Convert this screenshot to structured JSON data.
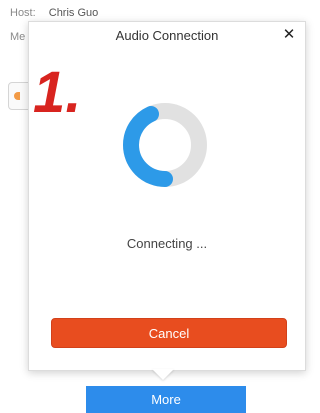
{
  "background": {
    "host_label": "Host:",
    "host_name": "Chris Guo",
    "meeting_label_partial": "Me",
    "more_label": "More"
  },
  "dialog": {
    "title": "Audio Connection",
    "close_glyph": "✕",
    "status_text": "Connecting ...",
    "cancel_label": "Cancel",
    "progress_fraction": 0.4
  },
  "annotation": {
    "step": "1."
  },
  "colors": {
    "spinner_track": "#e1e1e1",
    "spinner_arc": "#2d9ae8",
    "cancel": "#e84d1f",
    "more": "#2d8ceb",
    "annotation_red": "#d8241f"
  }
}
